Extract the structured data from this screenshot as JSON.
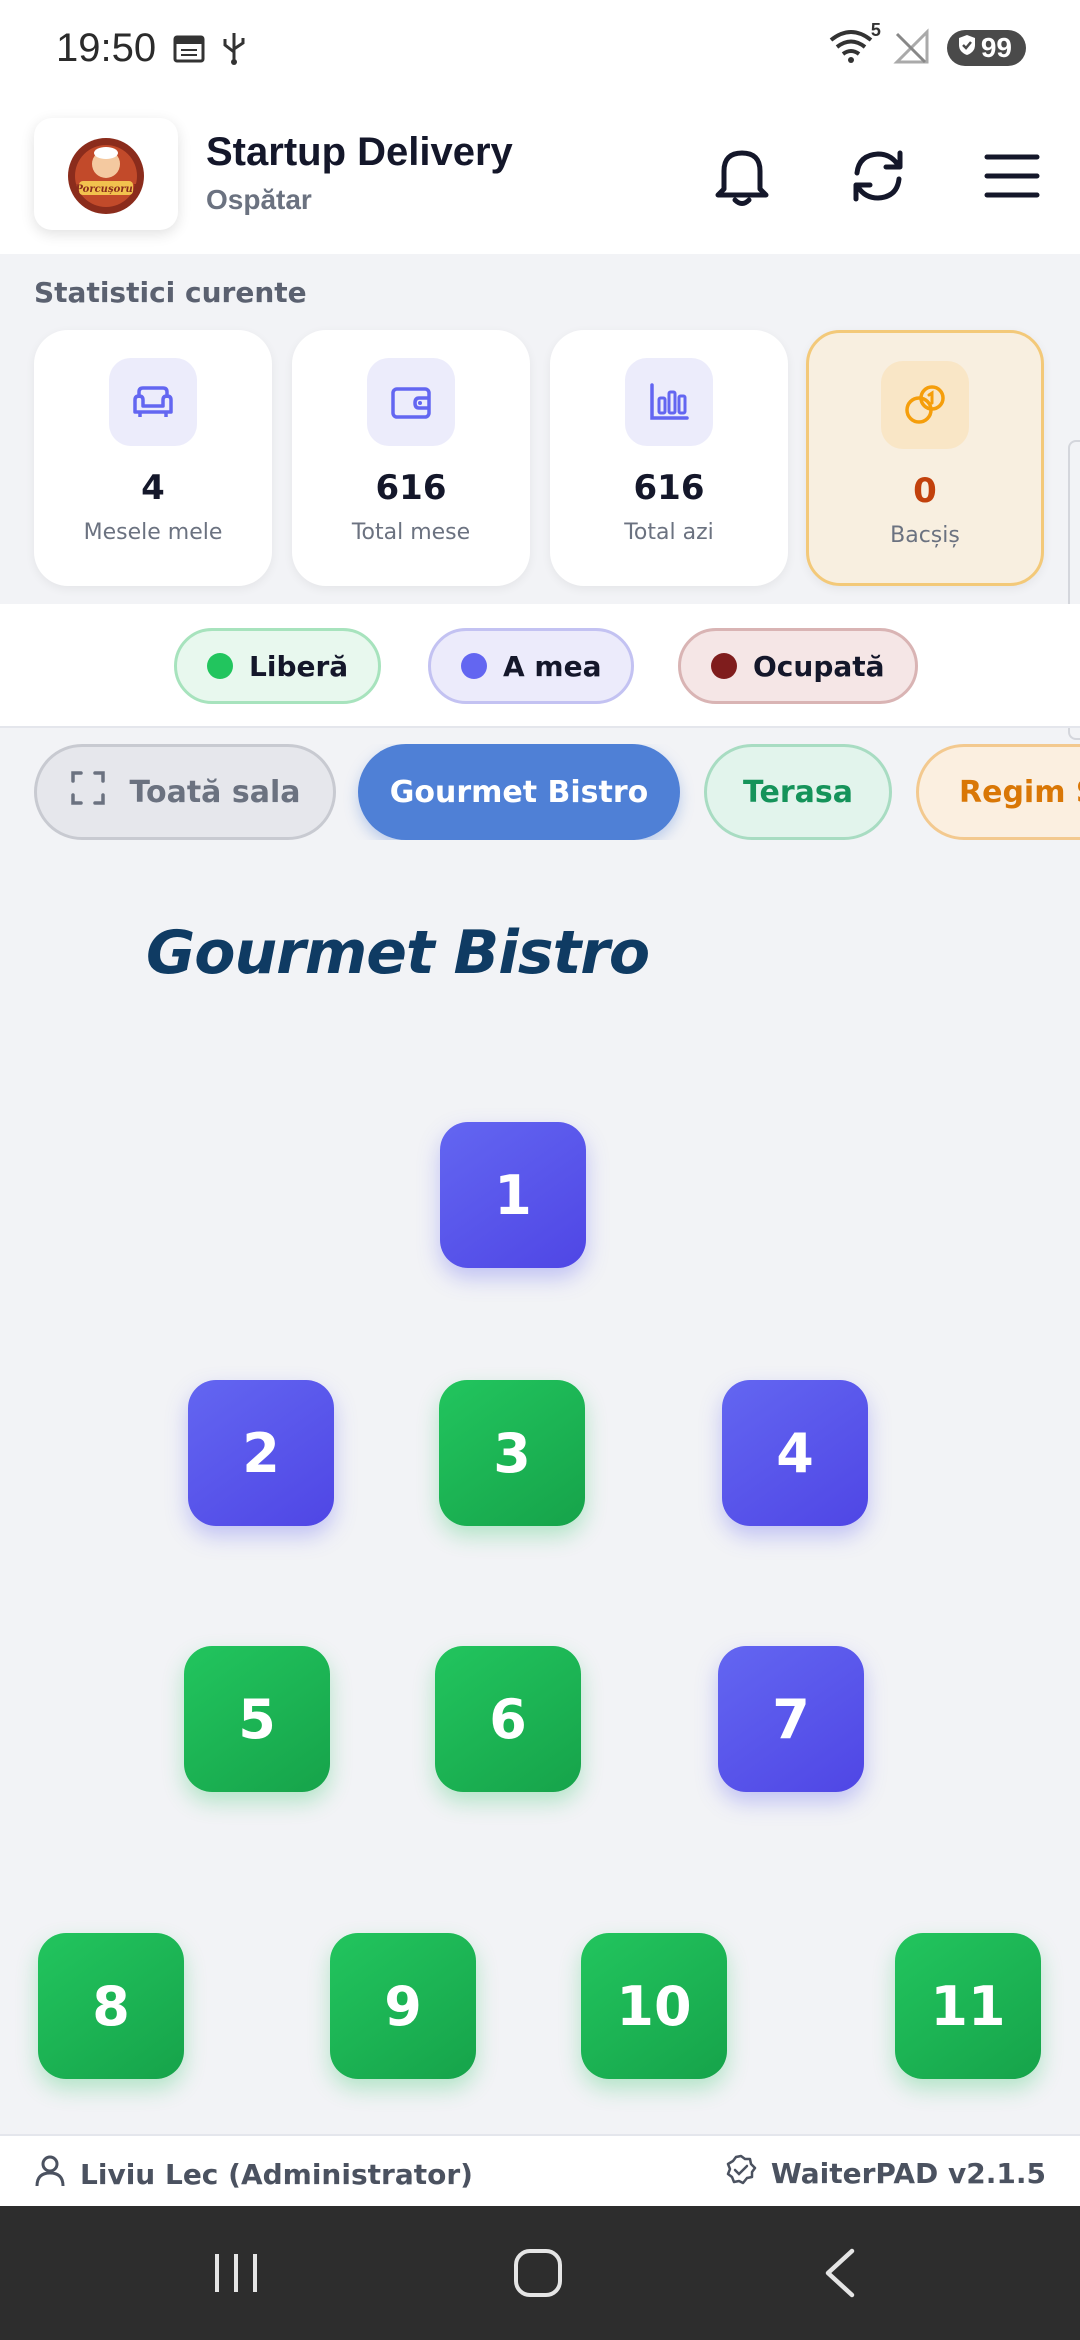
{
  "status_bar": {
    "time": "19:50",
    "battery": "99",
    "wifi_label": "5",
    "icons": [
      "calendar-icon",
      "usb-icon",
      "wifi-icon",
      "no-signal-icon",
      "battery-shield-icon"
    ]
  },
  "header": {
    "title": "Startup Delivery",
    "subtitle": "Ospătar",
    "logo_text": "Porcușorul",
    "actions": [
      "bell-icon",
      "refresh-icon",
      "menu-icon"
    ]
  },
  "stats": {
    "heading": "Statistici curente",
    "cards": [
      {
        "icon": "sofa-icon",
        "value": "4",
        "label": "Mesele mele"
      },
      {
        "icon": "wallet-icon",
        "value": "616",
        "label": "Total mese"
      },
      {
        "icon": "bar-chart-icon",
        "value": "616",
        "label": "Total azi"
      },
      {
        "icon": "coins-icon",
        "value": "0",
        "label": "Bacșiș"
      }
    ]
  },
  "legend": [
    {
      "label": "Liberă",
      "color": "#22c55e"
    },
    {
      "label": "A mea",
      "color": "#6366f1"
    },
    {
      "label": "Ocupată",
      "color": "#7f1d1d"
    }
  ],
  "rooms": {
    "tabs": [
      {
        "label": "Toată sala",
        "active": false
      },
      {
        "label": "Gourmet Bistro",
        "active": true
      },
      {
        "label": "Terasa",
        "active": false
      },
      {
        "label": "Regim S",
        "active": false
      }
    ]
  },
  "floor": {
    "title": "Gourmet Bistro",
    "tables": [
      {
        "label": "1",
        "status": "mine"
      },
      {
        "label": "2",
        "status": "mine"
      },
      {
        "label": "3",
        "status": "free"
      },
      {
        "label": "4",
        "status": "mine"
      },
      {
        "label": "5",
        "status": "free"
      },
      {
        "label": "6",
        "status": "free"
      },
      {
        "label": "7",
        "status": "mine"
      },
      {
        "label": "8",
        "status": "free"
      },
      {
        "label": "9",
        "status": "free"
      },
      {
        "label": "10",
        "status": "free"
      },
      {
        "label": "11",
        "status": "free"
      }
    ]
  },
  "footer": {
    "user": "Liviu Lec (Administrator)",
    "version": "WaiterPAD v2.1.5"
  },
  "colors": {
    "accent": "#4f80d6",
    "mine": "#5b5cf0",
    "free": "#22c55e",
    "occupied": "#7f1d1d",
    "floor_title": "#0f3b63"
  }
}
